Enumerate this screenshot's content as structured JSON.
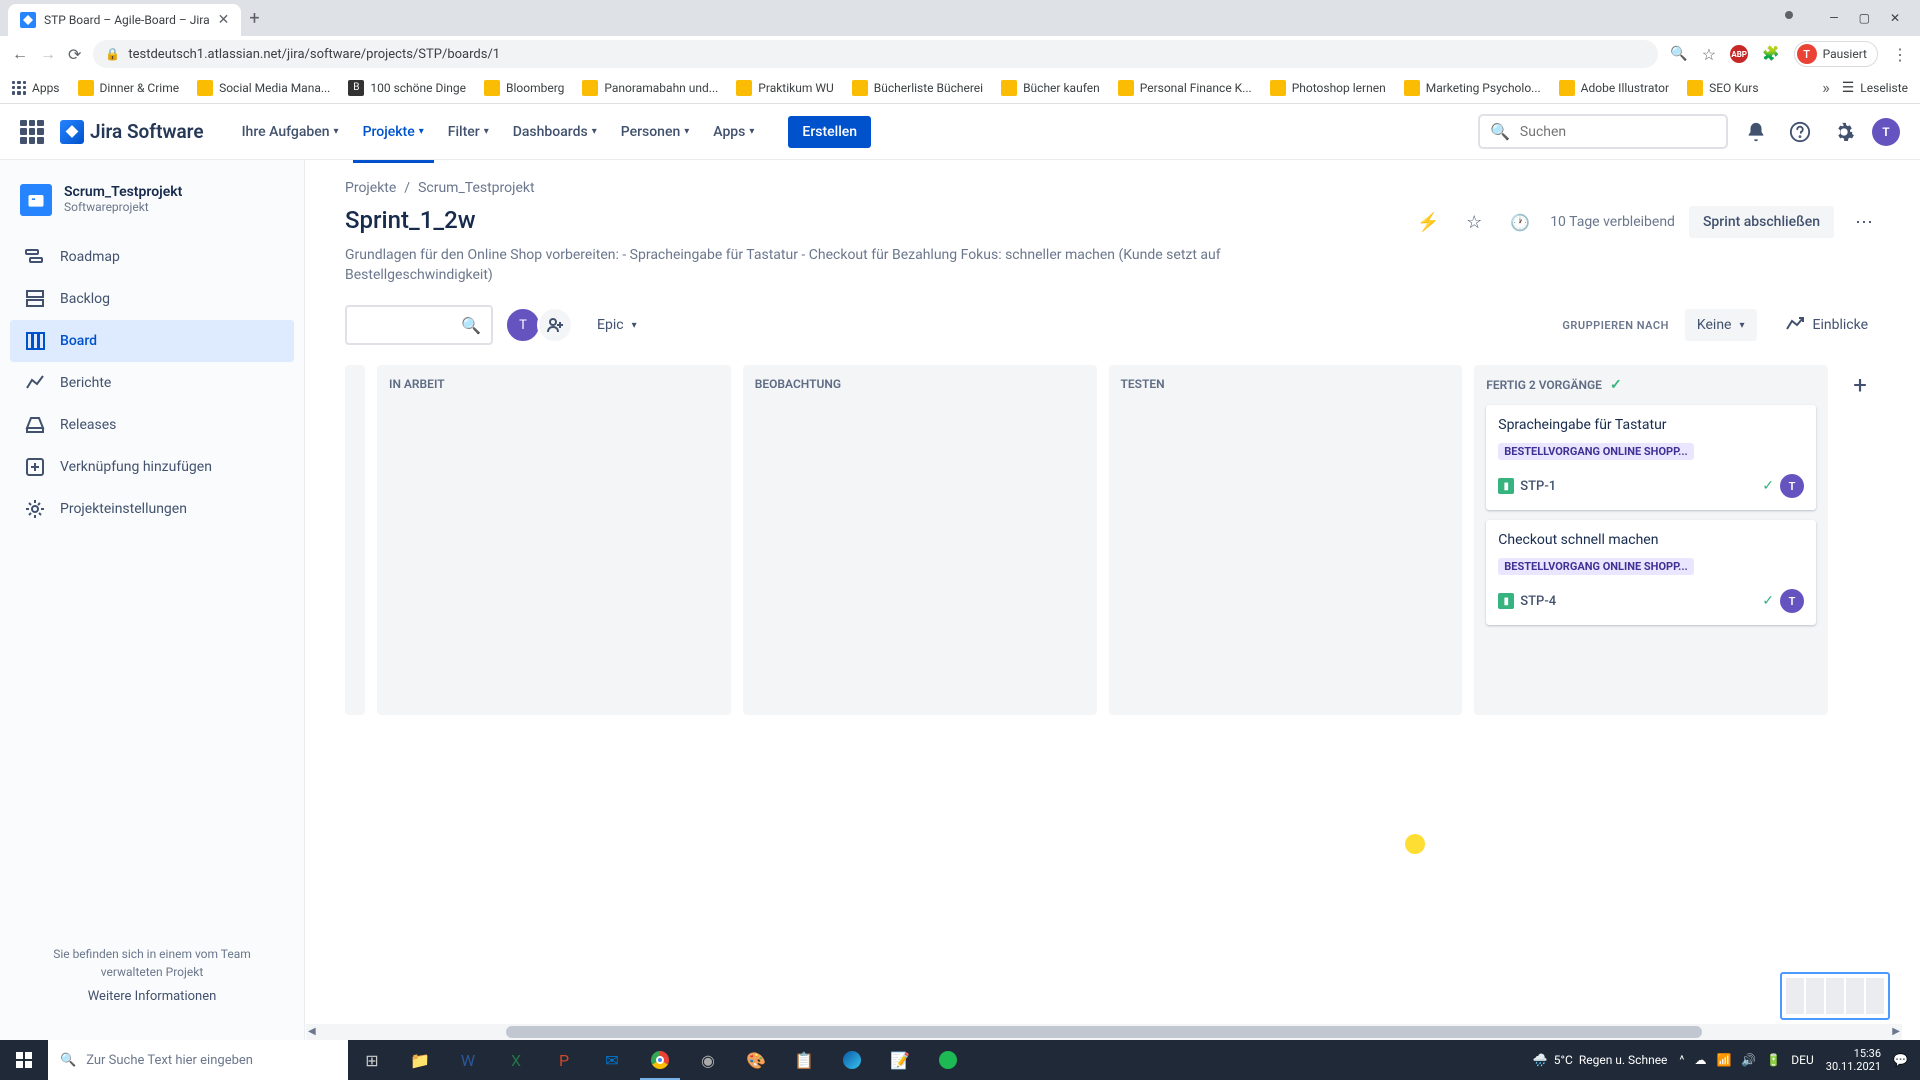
{
  "browser": {
    "tab_title": "STP Board – Agile-Board – Jira",
    "url": "testdeutsch1.atlassian.net/jira/software/projects/STP/boards/1",
    "profile_status": "Pausiert",
    "apps_label": "Apps",
    "readlist_label": "Leseliste",
    "bookmarks": [
      "Dinner & Crime",
      "Social Media Mana...",
      "100 schöne Dinge",
      "Bloomberg",
      "Panoramabahn und...",
      "Praktikum WU",
      "Bücherliste Bücherei",
      "Bücher kaufen",
      "Personal Finance K...",
      "Photoshop lernen",
      "Marketing Psycholo...",
      "Adobe Illustrator",
      "SEO Kurs"
    ]
  },
  "jira_header": {
    "logo": "Jira Software",
    "nav": {
      "your_work": "Ihre Aufgaben",
      "projects": "Projekte",
      "filters": "Filter",
      "dashboards": "Dashboards",
      "people": "Personen",
      "apps": "Apps"
    },
    "create": "Erstellen",
    "search_placeholder": "Suchen",
    "avatar_initial": "T"
  },
  "sidebar": {
    "project_name": "Scrum_Testprojekt",
    "project_type": "Softwareprojekt",
    "items": {
      "roadmap": "Roadmap",
      "backlog": "Backlog",
      "board": "Board",
      "reports": "Berichte",
      "releases": "Releases",
      "add_link": "Verknüpfung hinzufügen",
      "settings": "Projekteinstellungen"
    },
    "footer_text": "Sie befinden sich in einem vom Team verwalteten Projekt",
    "footer_link": "Weitere Informationen"
  },
  "main": {
    "breadcrumb": {
      "root": "Projekte",
      "sep": "/",
      "project": "Scrum_Testprojekt"
    },
    "sprint_title": "Sprint_1_2w",
    "days_remaining": "10 Tage verbleibend",
    "complete_sprint": "Sprint abschließen",
    "sprint_goal": "Grundlagen für den Online Shop vorbereiten: - Spracheingabe für Tastatur - Checkout für Bezahlung Fokus: schneller machen (Kunde setzt auf Bestellgeschwindigkeit)",
    "epic_filter": "Epic",
    "group_by_label": "GRUPPIEREN NACH",
    "group_by_value": "Keine",
    "insights": "Einblicke"
  },
  "columns": {
    "in_progress": "IN ARBEIT",
    "review": "BEOBACHTUNG",
    "test": "TESTEN",
    "done": "FERTIG 2 VORGÄNGE"
  },
  "cards": [
    {
      "title": "Spracheingabe für Tastatur",
      "epic": "BESTELLVORGANG ONLINE SHOPP...",
      "key": "STP-1",
      "assignee": "T"
    },
    {
      "title": "Checkout schnell machen",
      "epic": "BESTELLVORGANG ONLINE SHOPP...",
      "key": "STP-4",
      "assignee": "T"
    }
  ],
  "taskbar": {
    "search_placeholder": "Zur Suche Text hier eingeben",
    "temp": "5°C",
    "weather": "Regen u. Schnee",
    "lang": "DEU",
    "time": "15:36",
    "date": "30.11.2021"
  }
}
